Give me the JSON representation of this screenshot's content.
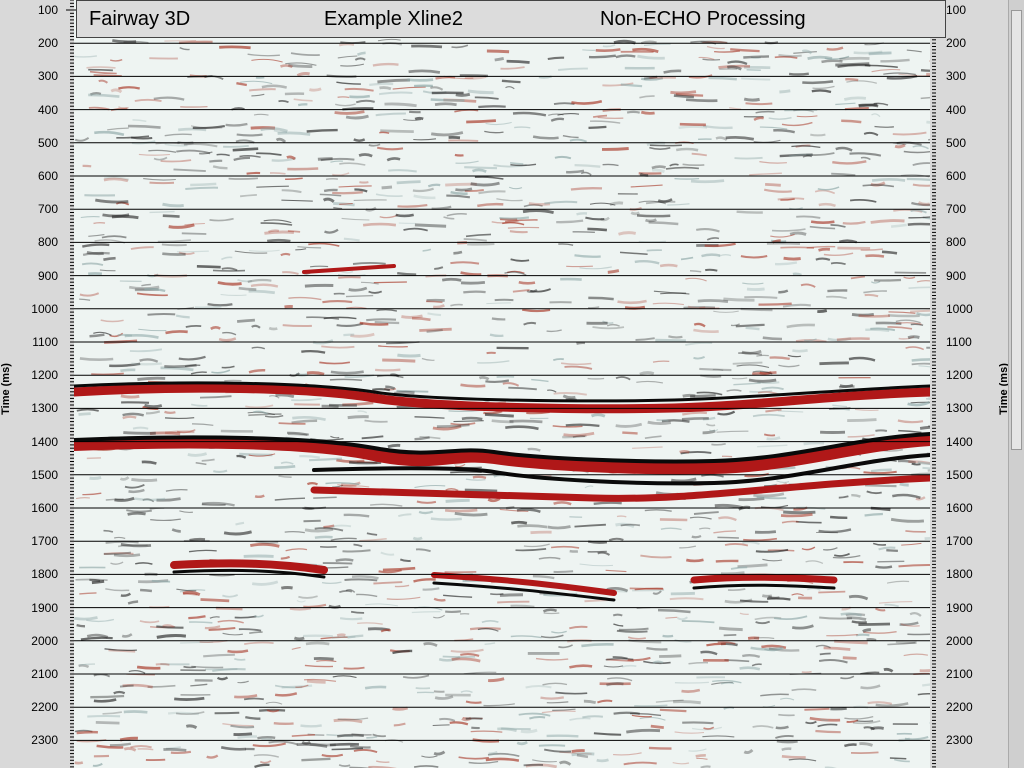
{
  "title": {
    "left": "Fairway 3D",
    "center": "Example Xline2",
    "right": "Non-ECHO Processing"
  },
  "axis": {
    "left_title": "Time (ms)",
    "right_title": "Time (ms)",
    "ticks": [
      "100",
      "200",
      "300",
      "400",
      "500",
      "600",
      "700",
      "800",
      "900",
      "1000",
      "1100",
      "1200",
      "1300",
      "1400",
      "1500",
      "1600",
      "1700",
      "1800",
      "1900",
      "2000",
      "2100",
      "2200",
      "2300"
    ]
  },
  "colors": {
    "peak": "#b01818",
    "trough": "#0a0a0a",
    "background": "#eef4f2"
  },
  "icons": {
    "scrollbar": "vertical-scrollbar"
  }
}
